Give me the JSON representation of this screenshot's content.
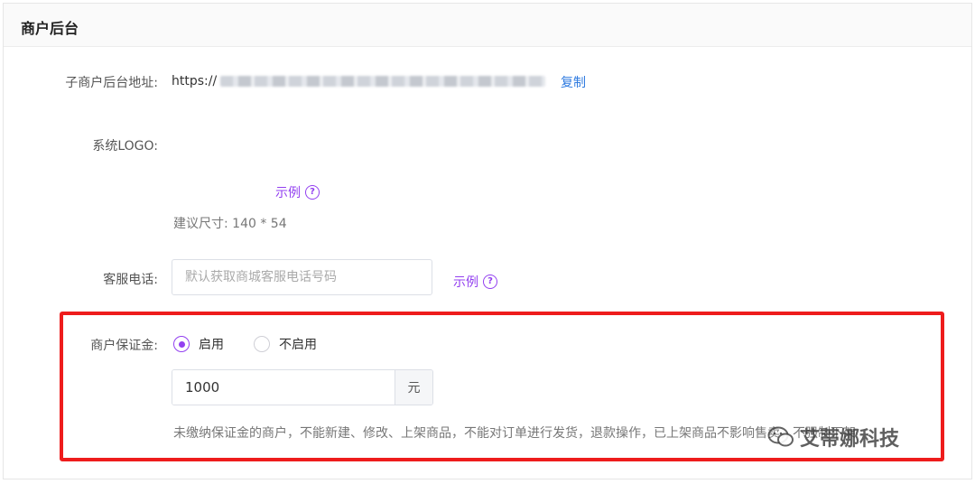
{
  "card": {
    "title": "商户后台"
  },
  "admin_url": {
    "label": "子商户后台地址:",
    "prefix": "https://",
    "copy_label": "复制"
  },
  "logo": {
    "label": "系统LOGO:",
    "example_label": "示例",
    "size_hint": "建议尺寸: 140 * 54"
  },
  "service_phone": {
    "label": "客服电话:",
    "placeholder": "默认获取商城客服电话号码",
    "example_label": "示例"
  },
  "deposit": {
    "label": "商户保证金:",
    "options": [
      {
        "label": "启用",
        "selected": true
      },
      {
        "label": "不启用",
        "selected": false
      }
    ],
    "amount": "1000",
    "unit": "元",
    "note": "未缴纳保证金的商户，不能新建、修改、上架商品，不能对订单进行发货，退款操作，已上架商品不影响售卖，不强制下架"
  },
  "watermark": {
    "text": "艾蒂娜科技"
  },
  "colors": {
    "accent_purple": "#9340f0",
    "link_blue": "#2f7be0",
    "highlight_red": "#ee1c1c"
  }
}
